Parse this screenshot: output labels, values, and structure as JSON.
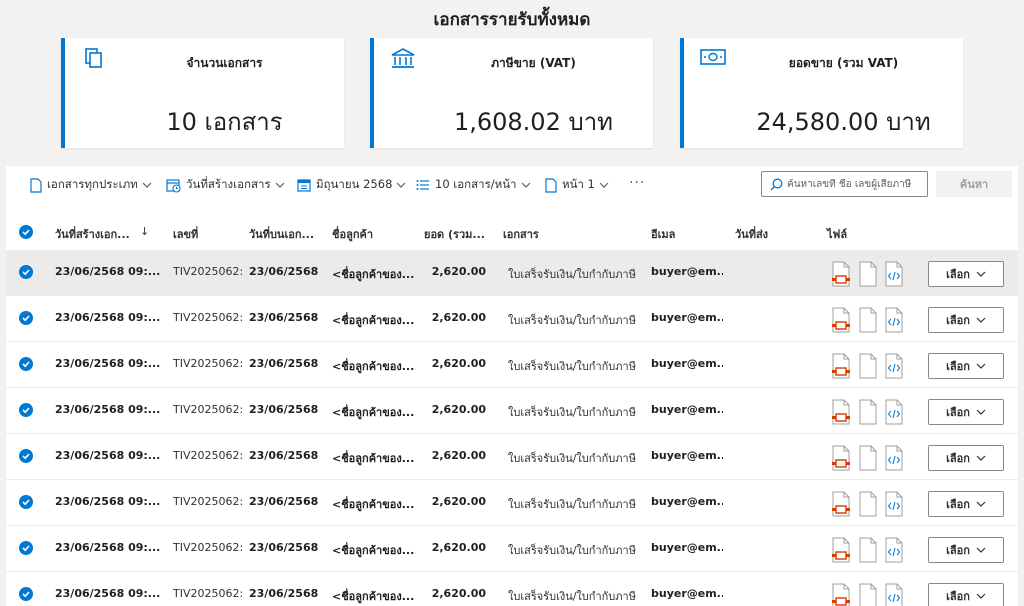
{
  "page": {
    "title": "เอกสารรายรับทั้งหมด"
  },
  "summary": {
    "count": {
      "label": "จำนวนเอกสาร",
      "value": "10 เอกสาร",
      "icon": "documents-icon"
    },
    "vat": {
      "label": "ภาษีขาย (VAT)",
      "value": "1,608.02 บาท",
      "icon": "bank-icon"
    },
    "total": {
      "label": "ยอดขาย (รวม VAT)",
      "value": "24,580.00 บาท",
      "icon": "money-icon"
    }
  },
  "toolbar": {
    "doc_type": "เอกสารทุกประเภท",
    "date_field": "วันที่สร้างเอกสาร",
    "month": "มิถุนายน 2568",
    "page_size": "10 เอกสาร/หน้า",
    "page": "หน้า 1",
    "more": "···",
    "search_placeholder": "ค้นหาเลขที่ ชื่อ เลขผู้เสียภาษี",
    "search_button": "ค้นหา"
  },
  "table": {
    "headers": {
      "created": "วันที่สร้างเอก...",
      "sort_indicator": "↓",
      "number": "เลขที่",
      "doc_date": "วันที่บนเอก...",
      "customer": "ชื่อลูกค้า",
      "amount": "ยอด (รวม...",
      "document": "เอกสาร",
      "email": "อีเมล",
      "sent_date": "วันที่ส่ง",
      "file": "ไฟล์"
    },
    "rows": [
      {
        "created": "23/06/2568 09:...",
        "number": "TIV2025062:",
        "doc_date": "23/06/2568",
        "customer": "<ชื่อลูกค้าของ...",
        "amount": "2,620.00",
        "document": "ใบเสร็จรับเงิน/ใบกำกับภาษี",
        "email": "buyer@em...",
        "sent_date": "",
        "action": "เลือก"
      },
      {
        "created": "23/06/2568 09:...",
        "number": "TIV2025062:",
        "doc_date": "23/06/2568",
        "customer": "<ชื่อลูกค้าของ...",
        "amount": "2,620.00",
        "document": "ใบเสร็จรับเงิน/ใบกำกับภาษี",
        "email": "buyer@em...",
        "sent_date": "",
        "action": "เลือก"
      },
      {
        "created": "23/06/2568 09:...",
        "number": "TIV2025062:",
        "doc_date": "23/06/2568",
        "customer": "<ชื่อลูกค้าของ...",
        "amount": "2,620.00",
        "document": "ใบเสร็จรับเงิน/ใบกำกับภาษี",
        "email": "buyer@em...",
        "sent_date": "",
        "action": "เลือก"
      },
      {
        "created": "23/06/2568 09:...",
        "number": "TIV2025062:",
        "doc_date": "23/06/2568",
        "customer": "<ชื่อลูกค้าของ...",
        "amount": "2,620.00",
        "document": "ใบเสร็จรับเงิน/ใบกำกับภาษี",
        "email": "buyer@em...",
        "sent_date": "",
        "action": "เลือก"
      },
      {
        "created": "23/06/2568 09:...",
        "number": "TIV2025062:",
        "doc_date": "23/06/2568",
        "customer": "<ชื่อลูกค้าของ...",
        "amount": "2,620.00",
        "document": "ใบเสร็จรับเงิน/ใบกำกับภาษี",
        "email": "buyer@em...",
        "sent_date": "",
        "action": "เลือก"
      },
      {
        "created": "23/06/2568 09:...",
        "number": "TIV2025062:",
        "doc_date": "23/06/2568",
        "customer": "<ชื่อลูกค้าของ...",
        "amount": "2,620.00",
        "document": "ใบเสร็จรับเงิน/ใบกำกับภาษี",
        "email": "buyer@em...",
        "sent_date": "",
        "action": "เลือก"
      },
      {
        "created": "23/06/2568 09:...",
        "number": "TIV2025062:",
        "doc_date": "23/06/2568",
        "customer": "<ชื่อลูกค้าของ...",
        "amount": "2,620.00",
        "document": "ใบเสร็จรับเงิน/ใบกำกับภาษี",
        "email": "buyer@em...",
        "sent_date": "",
        "action": "เลือก"
      },
      {
        "created": "23/06/2568 09:...",
        "number": "TIV2025062:",
        "doc_date": "23/06/2568",
        "customer": "<ชื่อลูกค้าของ...",
        "amount": "2,620.00",
        "document": "ใบเสร็จรับเงิน/ใบกำกับภาษี",
        "email": "buyer@em...",
        "sent_date": "",
        "action": "เลือก"
      }
    ],
    "file_icons": [
      "pdf-file-icon",
      "blank-file-icon",
      "xml-file-icon"
    ]
  },
  "colors": {
    "accent": "#0078d4",
    "pdf_red": "#d83b01",
    "selected_row": "#edebe9"
  }
}
